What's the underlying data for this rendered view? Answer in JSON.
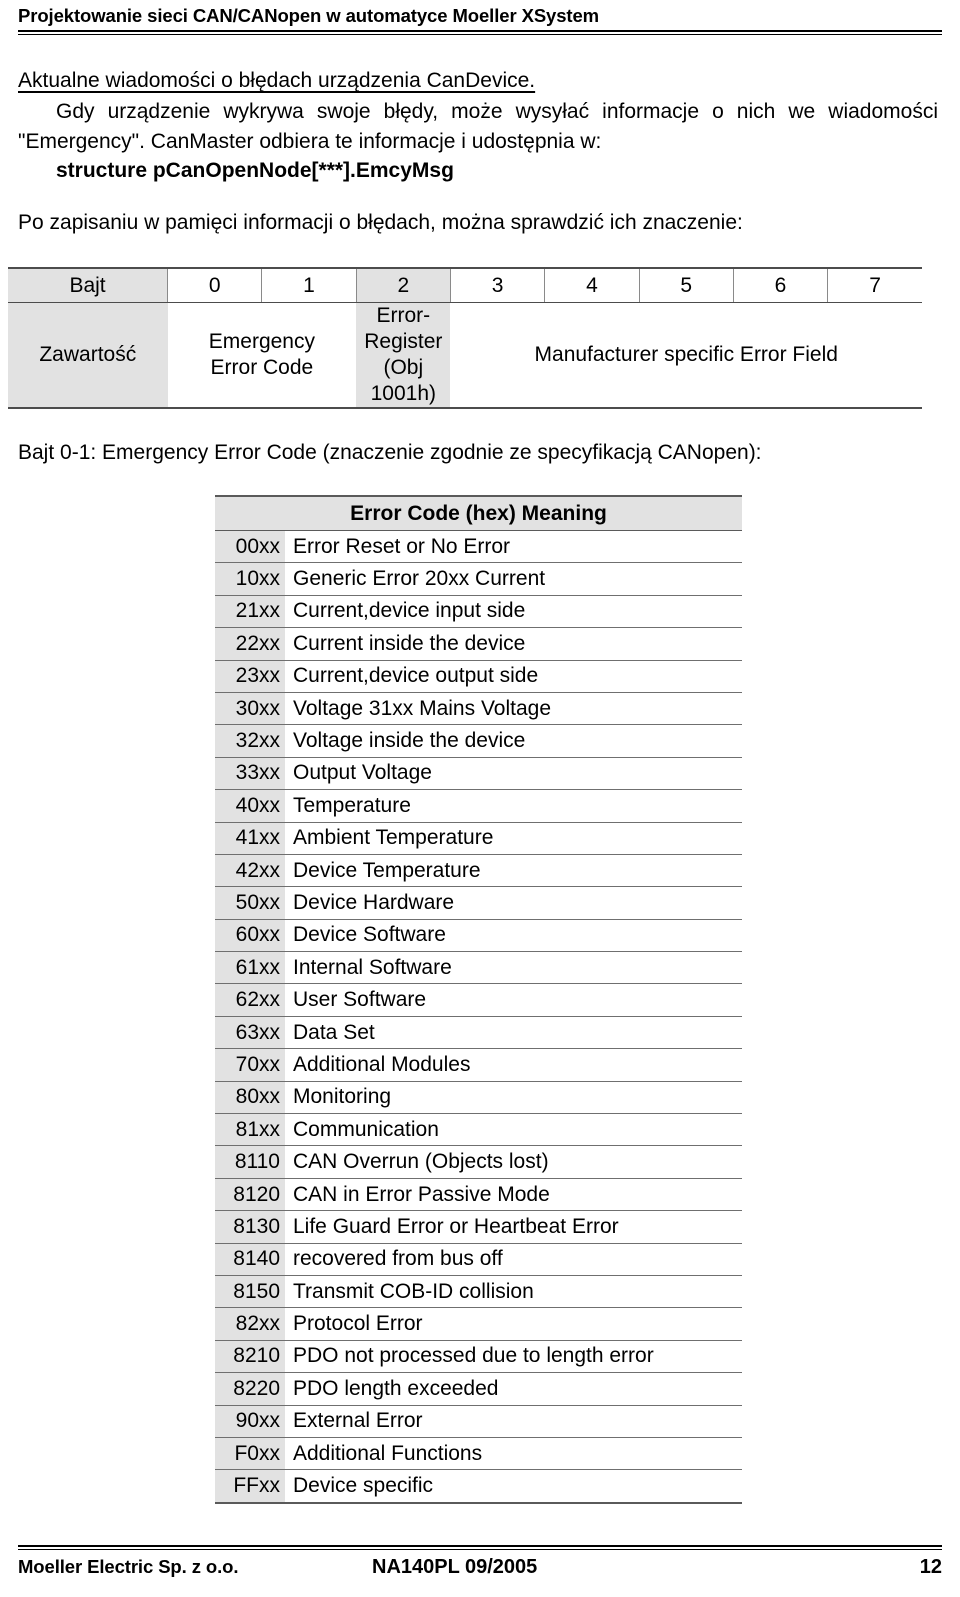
{
  "header": {
    "running_title": "Projektowanie sieci CAN/CANopen w automatyce Moeller XSystem"
  },
  "content": {
    "section_title": "Aktualne wiadomości o błędach urządzenia CanDevice.",
    "paragraph_1": "Gdy urządzenie wykrywa swoje błędy, może wysyłać informacje o nich we wiadomości \"Emergency\". CanMaster odbiera te informacje i udostępnia w:",
    "code_line": "structure pCanOpenNode[***].EmcyMsg",
    "paragraph_2": "Po zapisaniu w pamięci informacji o błędach, można sprawdzić ich znaczenie:",
    "byte_caption": "Bajt 0-1: Emergency Error Code (znaczenie zgodnie ze specyfikacją CANopen):"
  },
  "byte_table": {
    "row_label_bajt": "Bajt",
    "row_label_zawartosc": "Zawartość",
    "byte_numbers": [
      "0",
      "1",
      "2",
      "3",
      "4",
      "5",
      "6",
      "7"
    ],
    "cells": {
      "emergency_error_code": "Emergency\nError Code",
      "emergency_error_code_line1": "Emergency",
      "emergency_error_code_line2": "Error Code",
      "error_register_line1": "Error-",
      "error_register_line2": "Register",
      "error_register_line3": "(Obj",
      "error_register_line4": "1001h)",
      "manufacturer_field": "Manufacturer specific Error Field"
    }
  },
  "error_table": {
    "header": "Error Code (hex) Meaning",
    "rows": [
      {
        "code": "00xx",
        "meaning": "Error Reset or No Error"
      },
      {
        "code": "10xx",
        "meaning": "Generic Error 20xx Current"
      },
      {
        "code": "21xx",
        "meaning": "Current,device input side"
      },
      {
        "code": "22xx",
        "meaning": "Current inside the device"
      },
      {
        "code": "23xx",
        "meaning": "Current,device output side"
      },
      {
        "code": "30xx",
        "meaning": "Voltage 31xx Mains Voltage"
      },
      {
        "code": "32xx",
        "meaning": "Voltage inside the device"
      },
      {
        "code": "33xx",
        "meaning": "Output Voltage"
      },
      {
        "code": "40xx",
        "meaning": "Temperature"
      },
      {
        "code": "41xx",
        "meaning": "Ambient Temperature"
      },
      {
        "code": "42xx",
        "meaning": "Device Temperature"
      },
      {
        "code": "50xx",
        "meaning": "Device Hardware"
      },
      {
        "code": "60xx",
        "meaning": "Device Software"
      },
      {
        "code": "61xx",
        "meaning": "Internal Software"
      },
      {
        "code": "62xx",
        "meaning": "User Software"
      },
      {
        "code": "63xx",
        "meaning": "Data Set"
      },
      {
        "code": "70xx",
        "meaning": "Additional Modules"
      },
      {
        "code": "80xx",
        "meaning": "Monitoring"
      },
      {
        "code": "81xx",
        "meaning": "Communication"
      },
      {
        "code": "8110",
        "meaning": "CAN Overrun (Objects lost)"
      },
      {
        "code": "8120",
        "meaning": "CAN in Error Passive Mode"
      },
      {
        "code": "8130",
        "meaning": "Life Guard Error or Heartbeat Error"
      },
      {
        "code": "8140",
        "meaning": "recovered from bus off"
      },
      {
        "code": "8150",
        "meaning": "Transmit COB-ID collision"
      },
      {
        "code": "82xx",
        "meaning": "Protocol Error"
      },
      {
        "code": "8210",
        "meaning": "PDO not processed due to length error"
      },
      {
        "code": "8220",
        "meaning": "PDO length exceeded"
      },
      {
        "code": "90xx",
        "meaning": "External Error"
      },
      {
        "code": "F0xx",
        "meaning": "Additional Functions"
      },
      {
        "code": "FFxx",
        "meaning": "Device specific"
      }
    ]
  },
  "footer": {
    "left": "Moeller Electric Sp. z o.o.",
    "center": "NA140PL 09/2005",
    "page_number": "12"
  },
  "colors": {
    "shade": "#e2e2e2",
    "rule": "#000000",
    "table_border": "#5a5a5a"
  }
}
